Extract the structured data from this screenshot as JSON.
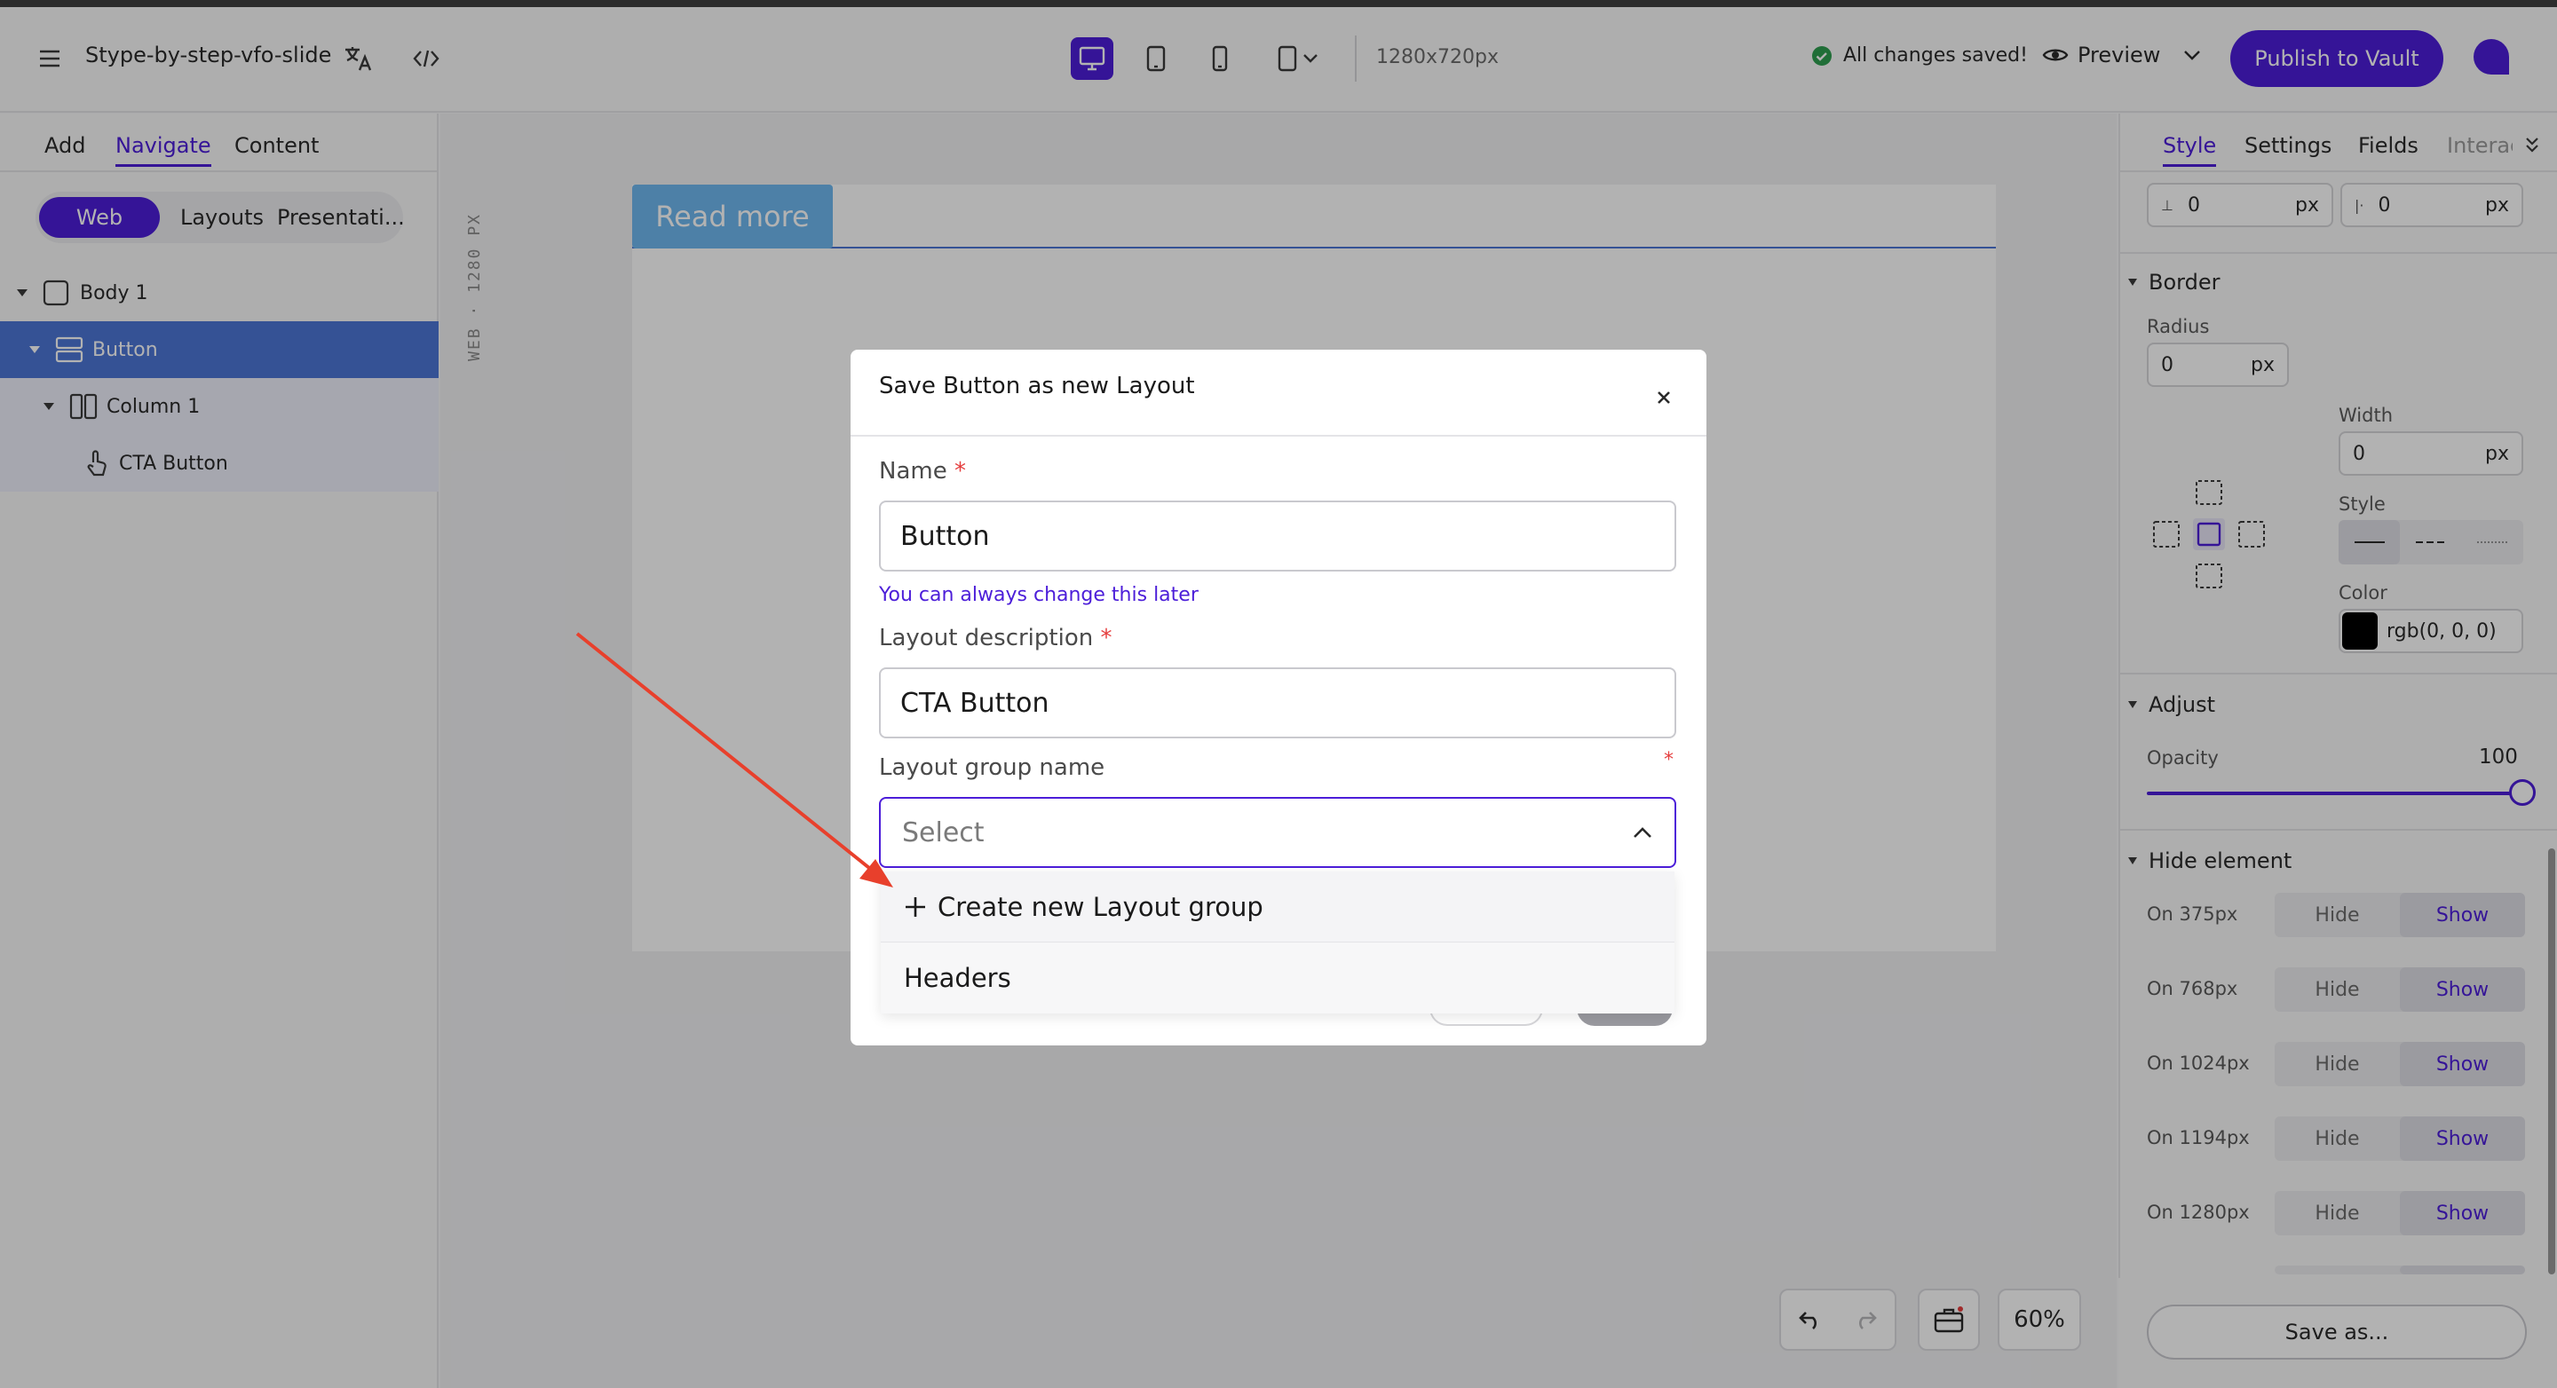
{
  "header": {
    "title": "Stype-by-step-vfo-slide",
    "dimensions": "1280x720px",
    "status": "All changes saved!",
    "preview_label": "Preview",
    "publish_label": "Publish to Vault"
  },
  "left_panel": {
    "tabs": [
      {
        "label": "Add",
        "active": false
      },
      {
        "label": "Navigate",
        "active": true
      },
      {
        "label": "Content",
        "active": false
      }
    ],
    "segments": [
      {
        "label": "Web",
        "active": true
      },
      {
        "label": "Layouts",
        "active": false
      },
      {
        "label": "Presentati...",
        "active": false
      }
    ],
    "tree": [
      {
        "label": "Body 1",
        "icon": "square-icon"
      },
      {
        "label": "Button",
        "icon": "rows-icon",
        "selected": true
      },
      {
        "label": "Column 1",
        "icon": "columns-icon"
      },
      {
        "label": "CTA Button",
        "icon": "pointer-icon"
      }
    ]
  },
  "canvas": {
    "ruler_label": "WEB · 1280 PX",
    "read_more_label": "Read more",
    "zoom": "60%"
  },
  "right_panel": {
    "tabs": [
      {
        "label": "Style",
        "active": true
      },
      {
        "label": "Settings",
        "active": false
      },
      {
        "label": "Fields",
        "active": false
      },
      {
        "label": "Interac",
        "active": false
      }
    ],
    "padding_top": {
      "value": "0",
      "unit": "px"
    },
    "padding_left": {
      "value": "0",
      "unit": "px"
    },
    "border": {
      "title": "Border",
      "radius_label": "Radius",
      "radius_value": "0",
      "radius_unit": "px",
      "width_label": "Width",
      "width_value": "0",
      "width_unit": "px",
      "style_label": "Style",
      "color_label": "Color",
      "color_value": "rgb(0, 0, 0)",
      "color_swatch": "#000000"
    },
    "adjust": {
      "title": "Adjust",
      "opacity_label": "Opacity",
      "opacity_value": "100"
    },
    "hide_element": {
      "title": "Hide element",
      "hide_label": "Hide",
      "show_label": "Show",
      "rows": [
        {
          "label": "On 375px"
        },
        {
          "label": "On 768px"
        },
        {
          "label": "On 1024px"
        },
        {
          "label": "On 1194px"
        },
        {
          "label": "On 1280px"
        }
      ]
    },
    "save_as_label": "Save as..."
  },
  "modal": {
    "title": "Save Button as new Layout",
    "name_label": "Name",
    "required_mark": "*",
    "name_value": "Button",
    "name_help": "You can always change this later",
    "description_label": "Layout description",
    "description_value": "CTA Button",
    "group_label": "Layout group name",
    "group_placeholder": "Select",
    "dropdown": {
      "create_label": "Create new Layout group",
      "options": [
        "Headers"
      ]
    }
  },
  "colors": {
    "accent": "#4c1ed9",
    "selection": "#4c76d6",
    "button": "#6fb8ef",
    "annotation_arrow": "#e8402c"
  }
}
